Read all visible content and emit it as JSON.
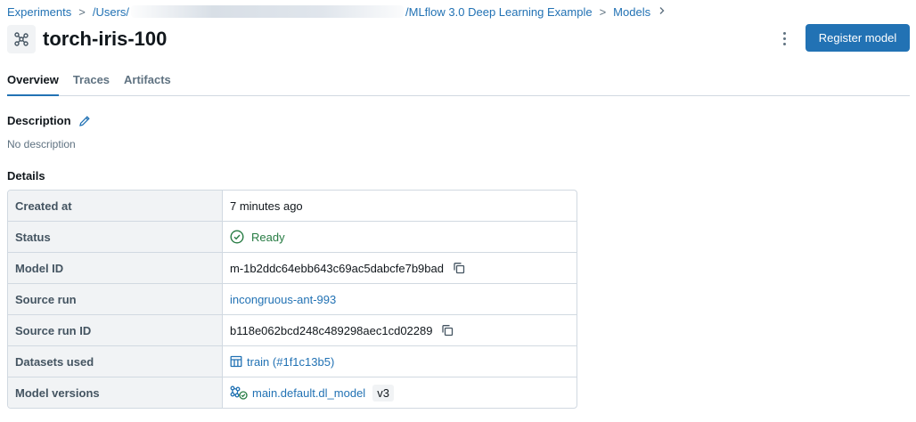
{
  "breadcrumb": {
    "items": [
      "Experiments",
      "/Users/",
      "/MLflow 3.0 Deep Learning Example",
      "Models"
    ]
  },
  "header": {
    "title": "torch-iris-100",
    "register_label": "Register model"
  },
  "tabs": [
    {
      "label": "Overview",
      "active": true
    },
    {
      "label": "Traces",
      "active": false
    },
    {
      "label": "Artifacts",
      "active": false
    }
  ],
  "description": {
    "heading": "Description",
    "text": "No description"
  },
  "details": {
    "heading": "Details",
    "rows": [
      {
        "label": "Created at",
        "value": "7 minutes ago"
      },
      {
        "label": "Status",
        "value": "Ready"
      },
      {
        "label": "Model ID",
        "value": "m-1b2ddc64ebb643c69ac5dabcfe7b9bad"
      },
      {
        "label": "Source run",
        "value": "incongruous-ant-993"
      },
      {
        "label": "Source run ID",
        "value": "b118e062bcd248c489298aec1cd02289"
      },
      {
        "label": "Datasets used",
        "value": "train (#1f1c13b5)"
      },
      {
        "label": "Model versions",
        "value": "main.default.dl_model",
        "tag": "v3"
      }
    ]
  },
  "colors": {
    "accent": "#2272b4",
    "success": "#277c43",
    "label_bg": "#f1f3f5",
    "border": "#d1d9e1"
  },
  "icons": [
    "model-icon",
    "kebab-menu-icon",
    "pencil-icon",
    "check-circle-icon",
    "copy-icon",
    "table-icon",
    "registered-model-icon",
    "chevron-right-icon"
  ]
}
